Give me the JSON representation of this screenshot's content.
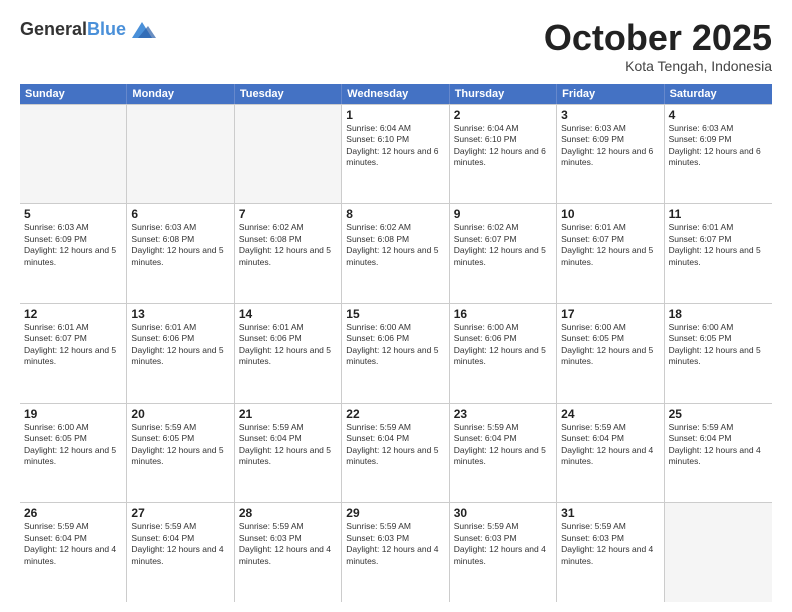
{
  "header": {
    "logo_general": "General",
    "logo_blue": "Blue",
    "month_title": "October 2025",
    "subtitle": "Kota Tengah, Indonesia"
  },
  "weekdays": [
    "Sunday",
    "Monday",
    "Tuesday",
    "Wednesday",
    "Thursday",
    "Friday",
    "Saturday"
  ],
  "weeks": [
    [
      {
        "day": "",
        "empty": true
      },
      {
        "day": "",
        "empty": true
      },
      {
        "day": "",
        "empty": true
      },
      {
        "day": "1",
        "sunrise": "Sunrise: 6:04 AM",
        "sunset": "Sunset: 6:10 PM",
        "daylight": "Daylight: 12 hours and 6 minutes."
      },
      {
        "day": "2",
        "sunrise": "Sunrise: 6:04 AM",
        "sunset": "Sunset: 6:10 PM",
        "daylight": "Daylight: 12 hours and 6 minutes."
      },
      {
        "day": "3",
        "sunrise": "Sunrise: 6:03 AM",
        "sunset": "Sunset: 6:09 PM",
        "daylight": "Daylight: 12 hours and 6 minutes."
      },
      {
        "day": "4",
        "sunrise": "Sunrise: 6:03 AM",
        "sunset": "Sunset: 6:09 PM",
        "daylight": "Daylight: 12 hours and 6 minutes."
      }
    ],
    [
      {
        "day": "5",
        "sunrise": "Sunrise: 6:03 AM",
        "sunset": "Sunset: 6:09 PM",
        "daylight": "Daylight: 12 hours and 5 minutes."
      },
      {
        "day": "6",
        "sunrise": "Sunrise: 6:03 AM",
        "sunset": "Sunset: 6:08 PM",
        "daylight": "Daylight: 12 hours and 5 minutes."
      },
      {
        "day": "7",
        "sunrise": "Sunrise: 6:02 AM",
        "sunset": "Sunset: 6:08 PM",
        "daylight": "Daylight: 12 hours and 5 minutes."
      },
      {
        "day": "8",
        "sunrise": "Sunrise: 6:02 AM",
        "sunset": "Sunset: 6:08 PM",
        "daylight": "Daylight: 12 hours and 5 minutes."
      },
      {
        "day": "9",
        "sunrise": "Sunrise: 6:02 AM",
        "sunset": "Sunset: 6:07 PM",
        "daylight": "Daylight: 12 hours and 5 minutes."
      },
      {
        "day": "10",
        "sunrise": "Sunrise: 6:01 AM",
        "sunset": "Sunset: 6:07 PM",
        "daylight": "Daylight: 12 hours and 5 minutes."
      },
      {
        "day": "11",
        "sunrise": "Sunrise: 6:01 AM",
        "sunset": "Sunset: 6:07 PM",
        "daylight": "Daylight: 12 hours and 5 minutes."
      }
    ],
    [
      {
        "day": "12",
        "sunrise": "Sunrise: 6:01 AM",
        "sunset": "Sunset: 6:07 PM",
        "daylight": "Daylight: 12 hours and 5 minutes."
      },
      {
        "day": "13",
        "sunrise": "Sunrise: 6:01 AM",
        "sunset": "Sunset: 6:06 PM",
        "daylight": "Daylight: 12 hours and 5 minutes."
      },
      {
        "day": "14",
        "sunrise": "Sunrise: 6:01 AM",
        "sunset": "Sunset: 6:06 PM",
        "daylight": "Daylight: 12 hours and 5 minutes."
      },
      {
        "day": "15",
        "sunrise": "Sunrise: 6:00 AM",
        "sunset": "Sunset: 6:06 PM",
        "daylight": "Daylight: 12 hours and 5 minutes."
      },
      {
        "day": "16",
        "sunrise": "Sunrise: 6:00 AM",
        "sunset": "Sunset: 6:06 PM",
        "daylight": "Daylight: 12 hours and 5 minutes."
      },
      {
        "day": "17",
        "sunrise": "Sunrise: 6:00 AM",
        "sunset": "Sunset: 6:05 PM",
        "daylight": "Daylight: 12 hours and 5 minutes."
      },
      {
        "day": "18",
        "sunrise": "Sunrise: 6:00 AM",
        "sunset": "Sunset: 6:05 PM",
        "daylight": "Daylight: 12 hours and 5 minutes."
      }
    ],
    [
      {
        "day": "19",
        "sunrise": "Sunrise: 6:00 AM",
        "sunset": "Sunset: 6:05 PM",
        "daylight": "Daylight: 12 hours and 5 minutes."
      },
      {
        "day": "20",
        "sunrise": "Sunrise: 5:59 AM",
        "sunset": "Sunset: 6:05 PM",
        "daylight": "Daylight: 12 hours and 5 minutes."
      },
      {
        "day": "21",
        "sunrise": "Sunrise: 5:59 AM",
        "sunset": "Sunset: 6:04 PM",
        "daylight": "Daylight: 12 hours and 5 minutes."
      },
      {
        "day": "22",
        "sunrise": "Sunrise: 5:59 AM",
        "sunset": "Sunset: 6:04 PM",
        "daylight": "Daylight: 12 hours and 5 minutes."
      },
      {
        "day": "23",
        "sunrise": "Sunrise: 5:59 AM",
        "sunset": "Sunset: 6:04 PM",
        "daylight": "Daylight: 12 hours and 5 minutes."
      },
      {
        "day": "24",
        "sunrise": "Sunrise: 5:59 AM",
        "sunset": "Sunset: 6:04 PM",
        "daylight": "Daylight: 12 hours and 4 minutes."
      },
      {
        "day": "25",
        "sunrise": "Sunrise: 5:59 AM",
        "sunset": "Sunset: 6:04 PM",
        "daylight": "Daylight: 12 hours and 4 minutes."
      }
    ],
    [
      {
        "day": "26",
        "sunrise": "Sunrise: 5:59 AM",
        "sunset": "Sunset: 6:04 PM",
        "daylight": "Daylight: 12 hours and 4 minutes."
      },
      {
        "day": "27",
        "sunrise": "Sunrise: 5:59 AM",
        "sunset": "Sunset: 6:04 PM",
        "daylight": "Daylight: 12 hours and 4 minutes."
      },
      {
        "day": "28",
        "sunrise": "Sunrise: 5:59 AM",
        "sunset": "Sunset: 6:03 PM",
        "daylight": "Daylight: 12 hours and 4 minutes."
      },
      {
        "day": "29",
        "sunrise": "Sunrise: 5:59 AM",
        "sunset": "Sunset: 6:03 PM",
        "daylight": "Daylight: 12 hours and 4 minutes."
      },
      {
        "day": "30",
        "sunrise": "Sunrise: 5:59 AM",
        "sunset": "Sunset: 6:03 PM",
        "daylight": "Daylight: 12 hours and 4 minutes."
      },
      {
        "day": "31",
        "sunrise": "Sunrise: 5:59 AM",
        "sunset": "Sunset: 6:03 PM",
        "daylight": "Daylight: 12 hours and 4 minutes."
      },
      {
        "day": "",
        "empty": true
      }
    ]
  ]
}
